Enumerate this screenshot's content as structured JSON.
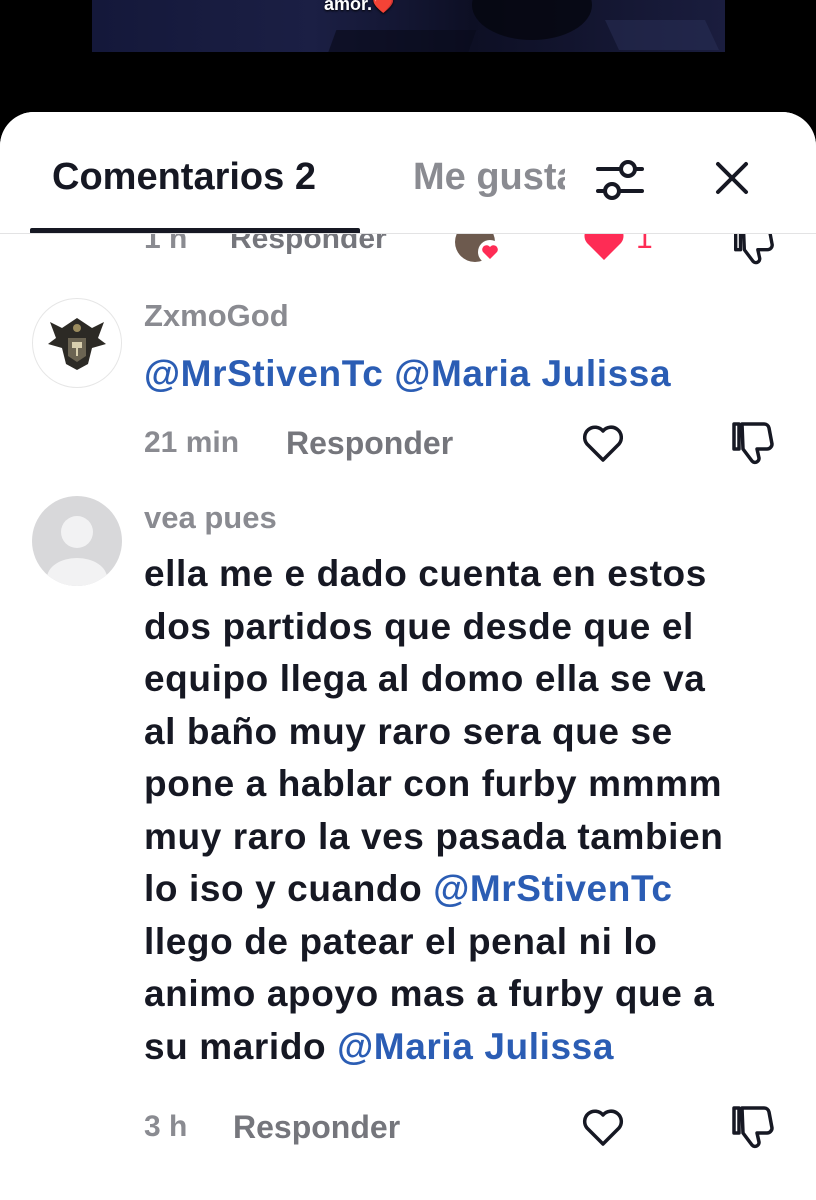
{
  "video": {
    "caption": "amor.",
    "caption_emoji": "❤️"
  },
  "tabs": {
    "comments_label": "Comentarios 2",
    "likes_label": "Me gusta"
  },
  "previous_comment": {
    "time": "1 h",
    "reply_label": "Responder",
    "like_count": "1"
  },
  "comments": [
    {
      "username": "ZxmoGod",
      "text_parts": [
        "@MrStivenTc",
        " ",
        "@Maria Julissa"
      ],
      "time": "21 min",
      "reply_label": "Responder"
    },
    {
      "username": "vea pues",
      "lines": [
        "ella me e dado cuenta en estos",
        "dos partidos que desde que el",
        "equipo llega al domo ella se va",
        "al baño muy raro sera que se",
        "pone a hablar con furby mmmm",
        "muy raro la ves pasada tambien",
        "lo iso y cuando ",
        "@MrStivenTc",
        "llego de patear el penal ni lo",
        "animo apoyo mas a furby que a",
        "su marido ",
        "@Maria Julissa"
      ],
      "time": "3 h",
      "reply_label": "Responder"
    }
  ],
  "colors": {
    "mention": "#2b5db4",
    "like_active": "#fe2c55",
    "text_primary": "#161823",
    "text_secondary": "#8a8b91"
  }
}
